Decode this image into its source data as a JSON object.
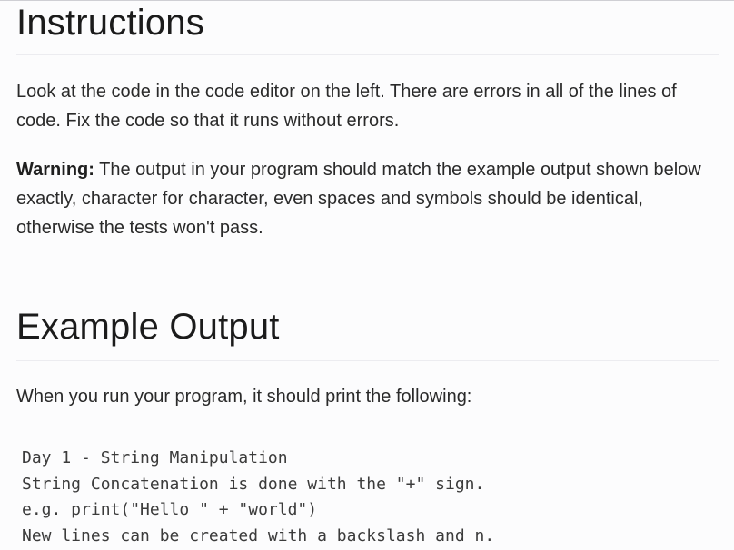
{
  "instructions": {
    "title": "Instructions",
    "paragraph_1": "Look at the code in the code editor on the left. There are errors in all of the lines of code. Fix the code so that it runs without errors.",
    "warning_label": "Warning:",
    "warning_text": " The output in your program should match the example output shown below exactly, character for character, even spaces and symbols should be identical, otherwise the tests won't pass."
  },
  "example_output": {
    "title": "Example Output",
    "intro": "When you run your program, it should print the following:",
    "lines": [
      "Day 1 - String Manipulation",
      "String Concatenation is done with the \"+\" sign.",
      "e.g. print(\"Hello \" + \"world\")",
      "New lines can be created with a backslash and n."
    ]
  }
}
